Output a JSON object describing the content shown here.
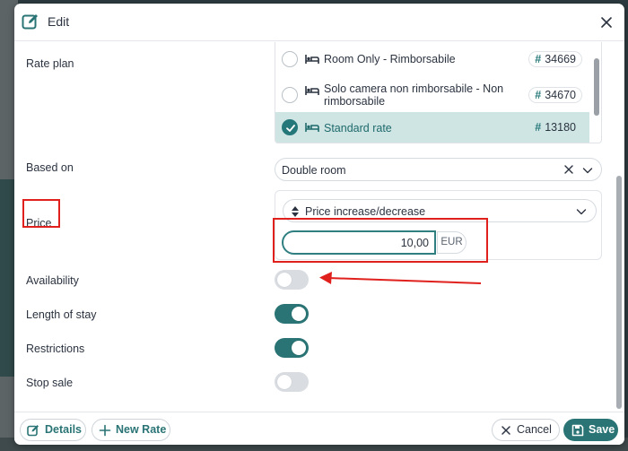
{
  "modal": {
    "title": "Edit"
  },
  "labels": {
    "rate_plan": "Rate plan",
    "based_on": "Based on",
    "price": "Price",
    "availability": "Availability",
    "length_of_stay": "Length of stay",
    "restrictions": "Restrictions",
    "stop_sale": "Stop sale"
  },
  "rate_plans": [
    {
      "name": "Room Only - Rimborsabile",
      "code": "34669",
      "selected": false
    },
    {
      "name": "Solo camera non rimborsabile - Non rimborsabile",
      "code": "34670",
      "selected": false
    },
    {
      "name": "Standard rate",
      "code": "13180",
      "selected": true
    }
  ],
  "based_on": {
    "value": "Double room"
  },
  "price": {
    "type": "Price increase/decrease",
    "amount": "10,00",
    "currency": "EUR"
  },
  "toggles": {
    "availability": false,
    "length_of_stay": true,
    "restrictions": true,
    "stop_sale": false
  },
  "footer": {
    "details": "Details",
    "new_rate": "New Rate",
    "cancel": "Cancel",
    "save": "Save"
  },
  "colors": {
    "accent": "#2a7475",
    "selected_row": "#cfe5e3",
    "annotation": "#e0201d"
  }
}
